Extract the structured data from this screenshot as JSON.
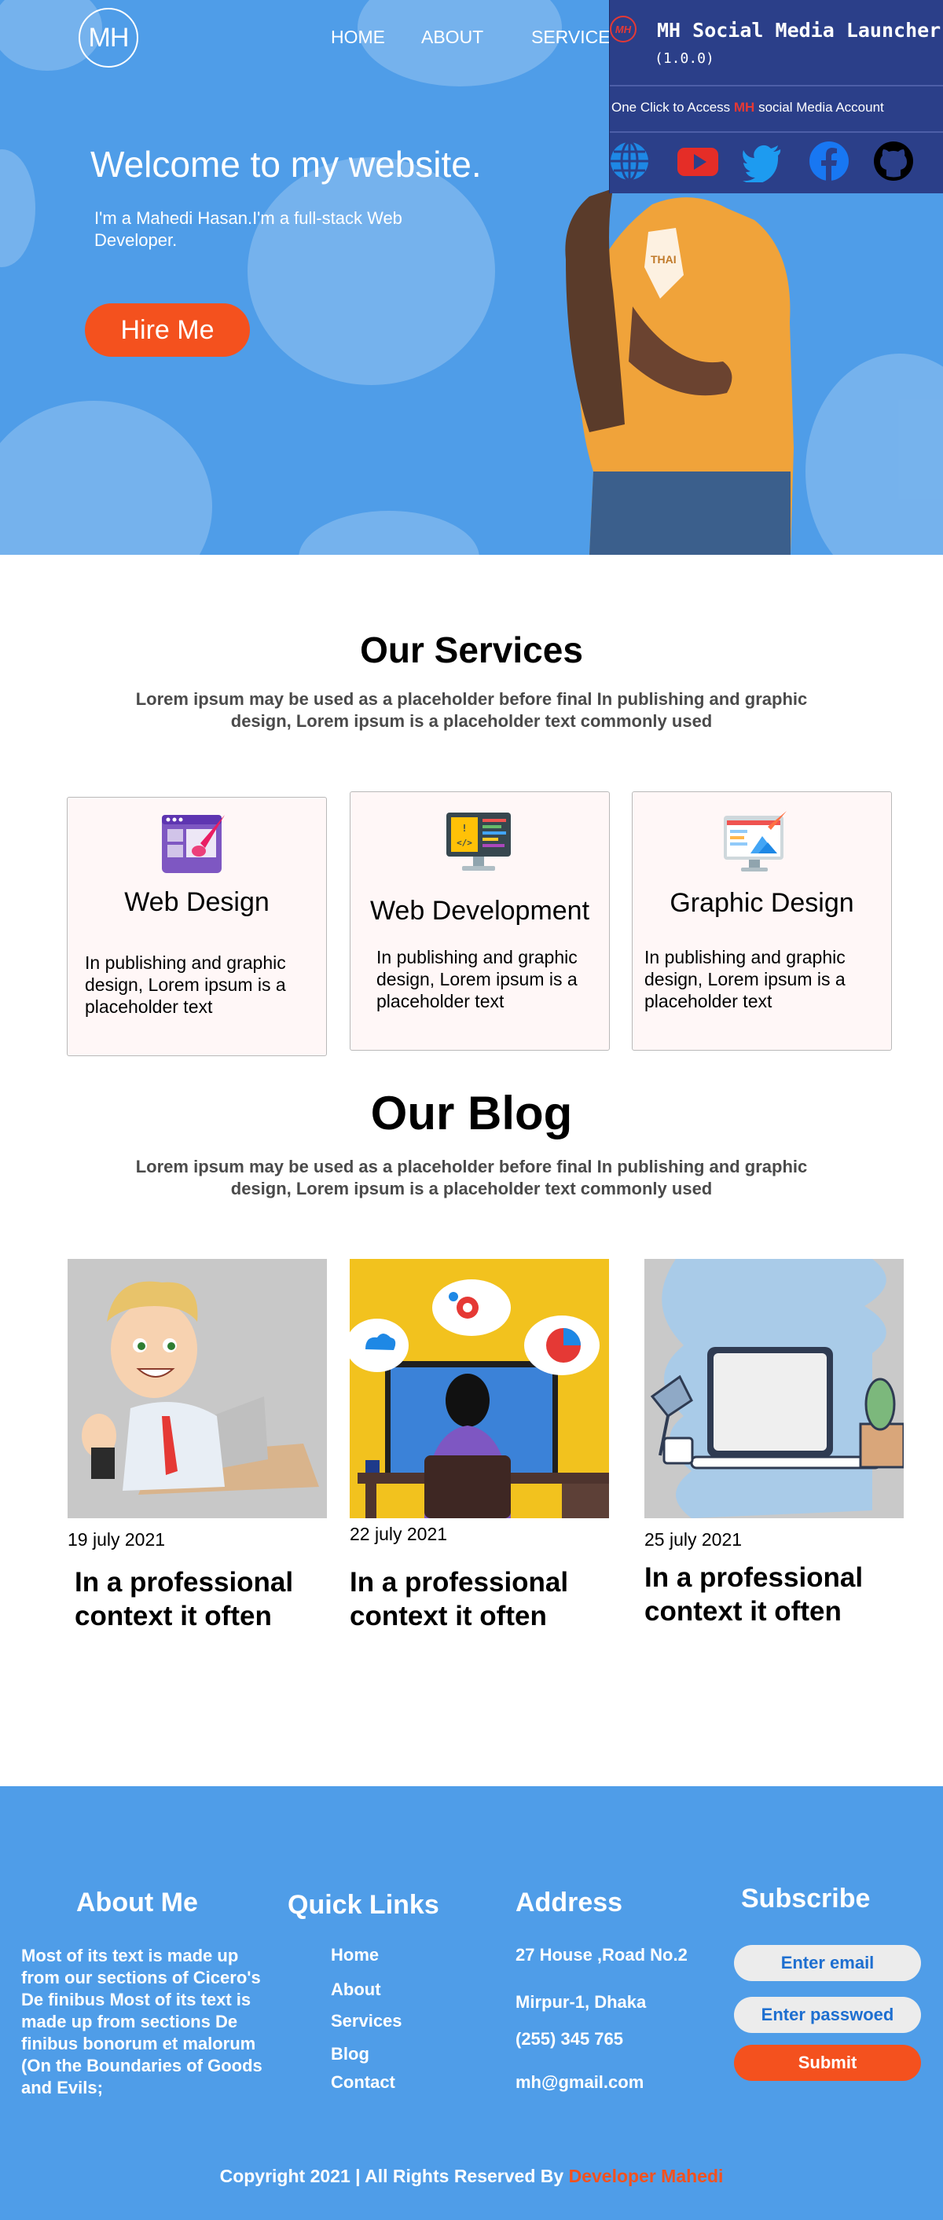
{
  "header": {
    "logo_text": "MH",
    "nav": [
      {
        "label": "HOME"
      },
      {
        "label": "ABOUT"
      },
      {
        "label": "SERVICES"
      }
    ]
  },
  "hero": {
    "title": "Welcome to my website.",
    "subtitle": "I'm a Mahedi Hasan.I'm a full-stack Web Developer.",
    "hire_button": "Hire Me"
  },
  "popup": {
    "badge": "MH",
    "title": "MH Social Media Launcher",
    "version": "(1.0.0)",
    "tagline_before": "One Click to Access ",
    "tagline_brand": "MH",
    "tagline_after": " social Media Account",
    "icons": [
      "globe-icon",
      "youtube-icon",
      "twitter-icon",
      "facebook-icon",
      "github-icon"
    ]
  },
  "services": {
    "title": "Our Services",
    "description": "Lorem ipsum may be used as a placeholder before final In publishing and graphic design, Lorem ipsum is a placeholder text commonly used",
    "cards": [
      {
        "title": "Web Design",
        "text": "In publishing and graphic design, Lorem ipsum is a placeholder text"
      },
      {
        "title": "Web Development",
        "text": "In publishing and graphic design, Lorem ipsum is a placeholder text"
      },
      {
        "title": "Graphic Design",
        "text": "In publishing and graphic design, Lorem ipsum is a placeholder text"
      }
    ]
  },
  "blog": {
    "title": "Our Blog",
    "description": "Lorem ipsum may be used as a placeholder before final In publishing and graphic design, Lorem ipsum is a placeholder text commonly used",
    "posts": [
      {
        "date": "19 july 2021",
        "title": "In a professional context it often"
      },
      {
        "date": "22 july 2021",
        "title": "In a professional context it often"
      },
      {
        "date": "25 july 2021",
        "title": "In a professional context it often"
      }
    ]
  },
  "footer": {
    "about": {
      "title": "About Me",
      "text": "Most of its text is made up from our sections of Cicero's De finibus  Most of its text is made up from sections  De finibus bonorum et malorum (On the Boundaries of Goods and Evils;"
    },
    "quick_links": {
      "title": "Quick Links",
      "links": [
        "Home",
        "About",
        "Services",
        "Blog",
        "Contact"
      ]
    },
    "address": {
      "title": "Address",
      "lines": [
        "27 House ,Road No.2",
        "Mirpur-1, Dhaka",
        "(255) 345 765",
        "mh@gmail.com"
      ]
    },
    "subscribe": {
      "title": "Subscribe",
      "email_placeholder": "Enter email",
      "password_placeholder": "Enter passwoed",
      "submit": "Submit"
    },
    "copyright_prefix": "Copyright 2021 | All Rights Reserved By ",
    "copyright_name": "Developer Mahedi"
  },
  "colors": {
    "hero_blue": "#4f9de8",
    "accent_orange": "#f4511e",
    "popup_navy": "#2b3f89",
    "card_bg": "#fff7f7"
  }
}
